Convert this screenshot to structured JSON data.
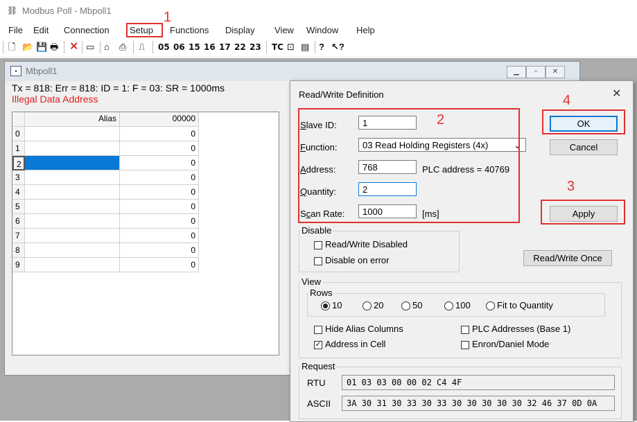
{
  "app": {
    "title": "Modbus Poll - Mbpoll1",
    "icon": "modbus-app-icon"
  },
  "menu": [
    "File",
    "Edit",
    "Connection",
    "Setup",
    "Functions",
    "Display",
    "View",
    "Window",
    "Help"
  ],
  "toolbar": {
    "codes": [
      "05",
      "06",
      "15",
      "16",
      "17",
      "22",
      "23"
    ],
    "tc_label": "TC",
    "icons": [
      "new-file-icon",
      "open-folder-icon",
      "save-icon",
      "print-icon",
      "delete-icon",
      "window-icon",
      "connect-icon",
      "print-preview-icon",
      "pulse-icon",
      "chart-icon",
      "monitor-icon",
      "help-icon",
      "context-help-icon"
    ]
  },
  "child": {
    "title": "Mbpoll1",
    "status": "Tx = 818: Err = 818: ID = 1: F = 03: SR = 1000ms",
    "error": "Illegal Data Address",
    "grid": {
      "headers": [
        "Alias",
        "00000"
      ],
      "rows": [
        {
          "index": "0",
          "value": "0"
        },
        {
          "index": "1",
          "value": "0"
        },
        {
          "index": "2",
          "value": "0"
        },
        {
          "index": "3",
          "value": "0"
        },
        {
          "index": "4",
          "value": "0"
        },
        {
          "index": "5",
          "value": "0"
        },
        {
          "index": "6",
          "value": "0"
        },
        {
          "index": "7",
          "value": "0"
        },
        {
          "index": "8",
          "value": "0"
        },
        {
          "index": "9",
          "value": "0"
        }
      ]
    }
  },
  "dialog": {
    "title": "Read/Write Definition",
    "slave_id_label": "Slave ID:",
    "slave_id": "1",
    "function_label": "Function:",
    "function": "03 Read Holding Registers (4x)",
    "address_label": "Address:",
    "address": "768",
    "plc_address": "PLC address = 40769",
    "quantity_label": "Quantity:",
    "quantity": "2",
    "scan_rate_label": "Scan Rate:",
    "scan_rate": "1000",
    "scan_unit": "[ms]",
    "ok": "OK",
    "cancel": "Cancel",
    "apply": "Apply",
    "disable_group": "Disable",
    "rw_disabled": "Read/Write Disabled",
    "disable_on_error": "Disable on error",
    "rw_once": "Read/Write Once",
    "view_group": "View",
    "rows_group": "Rows",
    "row_options": [
      "10",
      "20",
      "50",
      "100",
      "Fit to Quantity"
    ],
    "row_selected": "10",
    "hide_alias": "Hide Alias Columns",
    "plc_addresses": "PLC Addresses (Base 1)",
    "address_in_cell": "Address in Cell",
    "enron_daniel": "Enron/Daniel Mode",
    "request_group": "Request",
    "rtu_label": "RTU",
    "rtu_value": "01 03 03 00 00 02 C4 4F",
    "ascii_label": "ASCII",
    "ascii_value": "3A 30 31 30 33 30 33 30 30 30 30 30 32 46 37 0D 0A"
  },
  "annotations": [
    "1",
    "2",
    "3",
    "4"
  ],
  "colors": {
    "annotation": "#e23030",
    "error_text": "#e02020",
    "selected_cell": "#0a78d7"
  }
}
